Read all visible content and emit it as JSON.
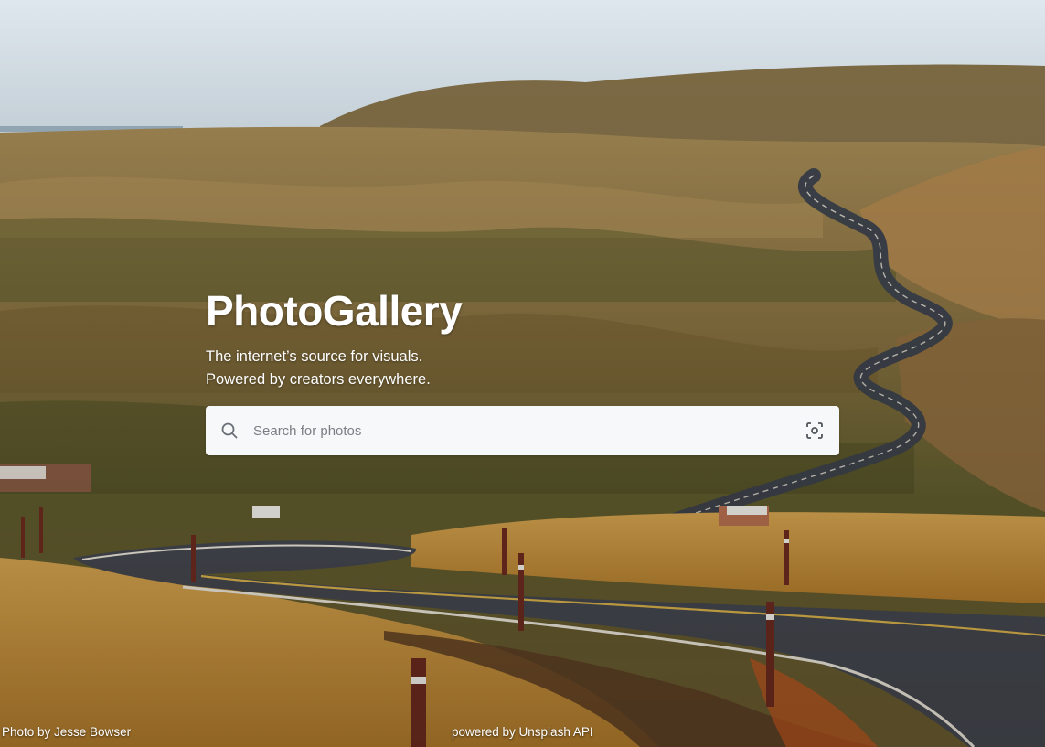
{
  "hero": {
    "title": "PhotoGallery",
    "tagline_line1": "The internet’s source for visuals.",
    "tagline_line2": "Powered by creators everywhere."
  },
  "search": {
    "placeholder": "Search for photos",
    "value": "",
    "icon": "search-icon",
    "visual_search_icon": "visual-search-icon"
  },
  "footer": {
    "photo_credit": "Photo by Jesse Bowser",
    "api_credit": "powered by Unsplash API"
  },
  "colors": {
    "title_text": "#ffffff",
    "search_bg": "#f7f8fa",
    "placeholder": "#7b7f85"
  }
}
